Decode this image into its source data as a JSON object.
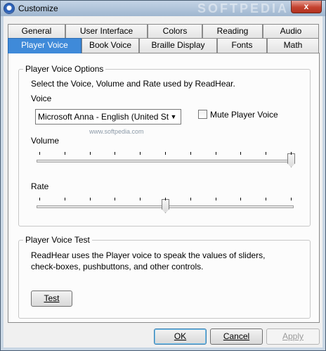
{
  "window": {
    "title": "Customize",
    "close_glyph": "x",
    "watermark": "SOFTPEDIA"
  },
  "tabs_row1": [
    "General",
    "User Interface",
    "Colors",
    "Reading",
    "Audio"
  ],
  "tabs_row2": [
    "Player Voice",
    "Book Voice",
    "Braille Display",
    "Fonts",
    "Math"
  ],
  "active_tab": "Player Voice",
  "options_group": {
    "legend": "Player Voice Options",
    "description": "Select the Voice, Volume and Rate used by ReadHear.",
    "voice_label": "Voice",
    "voice_value": "Microsoft Anna - English (United St",
    "voice_arrow": "▼",
    "watermark_url": "www.softpedia.com",
    "mute_label": "Mute Player Voice",
    "mute_checked": false,
    "volume_label": "Volume",
    "volume_level": 1.0,
    "rate_label": "Rate",
    "rate_level": 0.5
  },
  "test_group": {
    "legend": "Player Voice Test",
    "description_line1": "ReadHear uses the Player voice to speak the values of sliders,",
    "description_line2": "check-boxes, pushbuttons, and other controls.",
    "test_button_label": "Test"
  },
  "footer": {
    "ok_label": "OK",
    "cancel_label": "Cancel",
    "apply_label": "Apply"
  }
}
